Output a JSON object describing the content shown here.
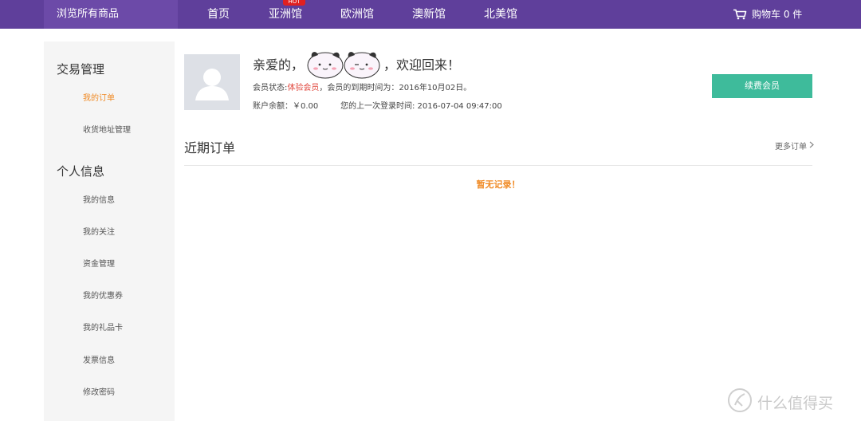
{
  "nav": {
    "browse_all": "浏览所有商品",
    "items": [
      "首页",
      "亚洲馆",
      "欧洲馆",
      "澳新馆",
      "北美馆"
    ],
    "hot_badge": "HOT",
    "cart_label": "购物车 0 件"
  },
  "sidebar": {
    "sections": [
      {
        "heading": "交易管理",
        "items": [
          "我的订单",
          "收货地址管理"
        ]
      },
      {
        "heading": "个人信息",
        "items": [
          "我的信息",
          "我的关注",
          "资金管理",
          "我的优惠券",
          "我的礼品卡",
          "发票信息",
          "修改密码"
        ]
      }
    ],
    "active_item": "我的订单"
  },
  "profile": {
    "greeting_pre": "亲爱的，",
    "greeting_post": "，欢迎回来！",
    "member_status_label": "会员状态:",
    "member_status_value": "体验会员",
    "expire_text": "，会员的到期时间为：2016年10月02日。",
    "balance": "账户余额：￥0.00",
    "last_login": "您的上一次登录时间: 2016-07-04 09:47:00",
    "renew_button": "续费会员"
  },
  "orders": {
    "title": "近期订单",
    "more": "更多订单",
    "empty": "暂无记录！"
  },
  "watermark": "什么值得买",
  "colors": {
    "nav_bg": "#5f3f9b",
    "accent_orange": "#f08a24",
    "renew_green": "#3ebb9b",
    "status_red": "#e0463c"
  }
}
